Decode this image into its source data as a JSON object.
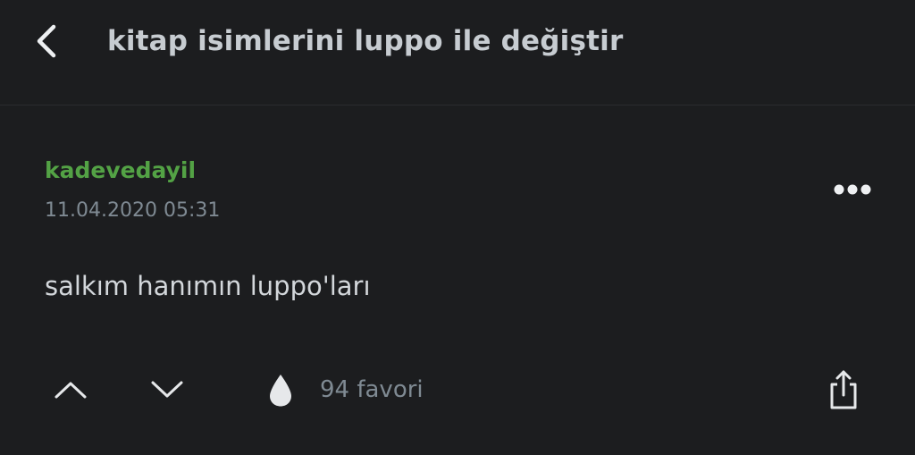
{
  "header": {
    "back_icon": "chevron-left-icon",
    "title": "kitap isimlerini luppo ile değiştir"
  },
  "entry": {
    "author": "kadevedayil",
    "date": "11.04.2020 05:31",
    "more_icon": "more-dots-icon",
    "content": "salkım hanımın luppo'ları"
  },
  "actions": {
    "upvote_icon": "chevron-up-icon",
    "downvote_icon": "chevron-down-icon",
    "favorite_icon": "drop-icon",
    "favorite_count": "94 favori",
    "share_icon": "share-icon"
  },
  "colors": {
    "background": "#1c1d1f",
    "author_green": "#53a245",
    "muted_text": "#7f8a93",
    "primary_text": "#d3d7db",
    "icon": "#e6e8ea"
  }
}
